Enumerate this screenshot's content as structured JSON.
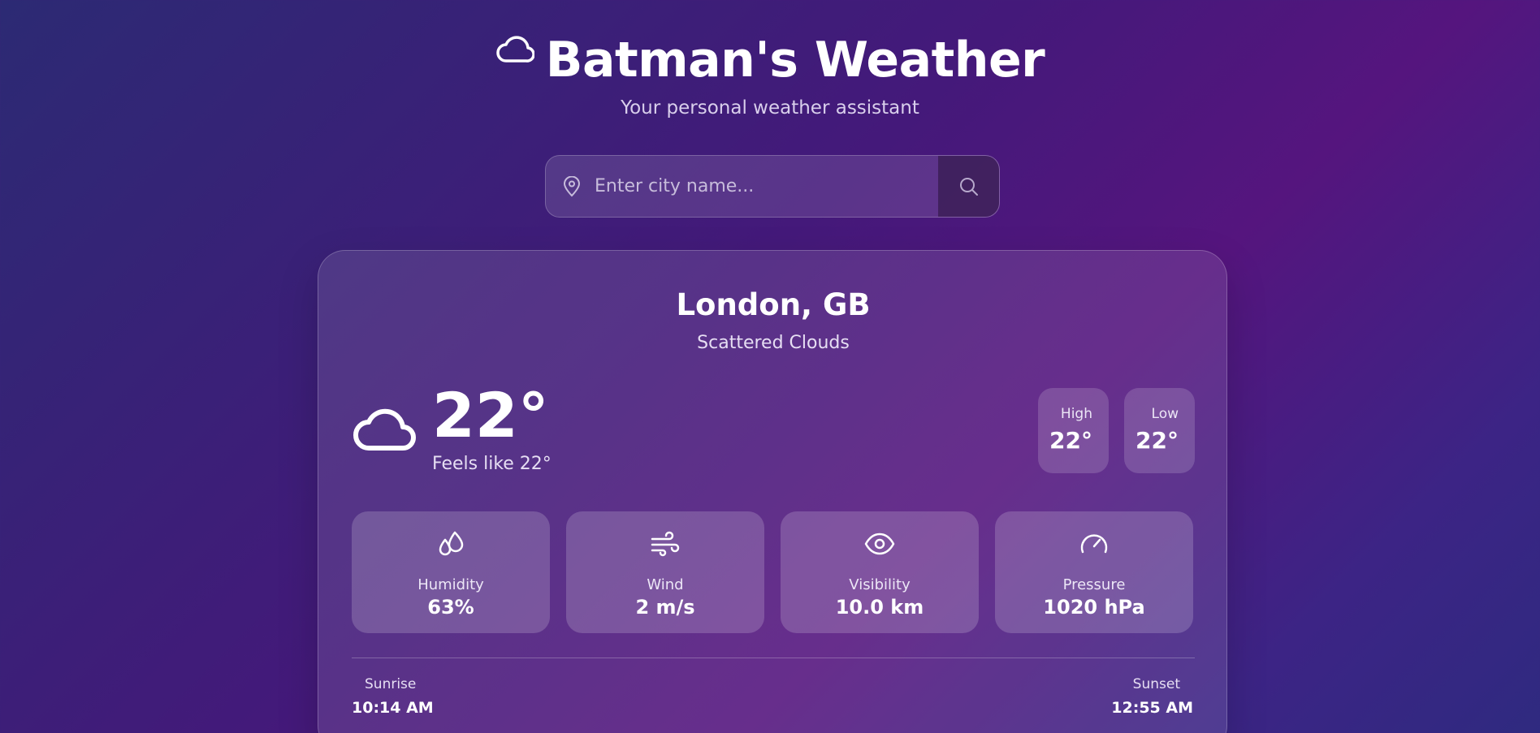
{
  "header": {
    "title": "Batman's Weather",
    "subtitle": "Your personal weather assistant",
    "logo_icon": "cloud-icon"
  },
  "search": {
    "placeholder": "Enter city name...",
    "value": "",
    "pin_icon": "map-pin-icon",
    "button_icon": "search-icon"
  },
  "weather": {
    "city": "London, GB",
    "condition": "Scattered Clouds",
    "icon": "cloud-icon",
    "temperature": "22°",
    "feels_like": "Feels like 22°",
    "high": {
      "label": "High",
      "value": "22°"
    },
    "low": {
      "label": "Low",
      "value": "22°"
    },
    "stats": [
      {
        "icon": "droplets-icon",
        "label": "Humidity",
        "value": "63%"
      },
      {
        "icon": "wind-icon",
        "label": "Wind",
        "value": "2 m/s"
      },
      {
        "icon": "eye-icon",
        "label": "Visibility",
        "value": "10.0 km"
      },
      {
        "icon": "gauge-icon",
        "label": "Pressure",
        "value": "1020 hPa"
      }
    ],
    "sunrise": {
      "label": "Sunrise",
      "value": "10:14 AM"
    },
    "sunset": {
      "label": "Sunset",
      "value": "12:55 AM"
    }
  },
  "colors": {
    "background_start": "#2c2a74",
    "background_mid": "#55157e",
    "text": "#ffffff"
  }
}
